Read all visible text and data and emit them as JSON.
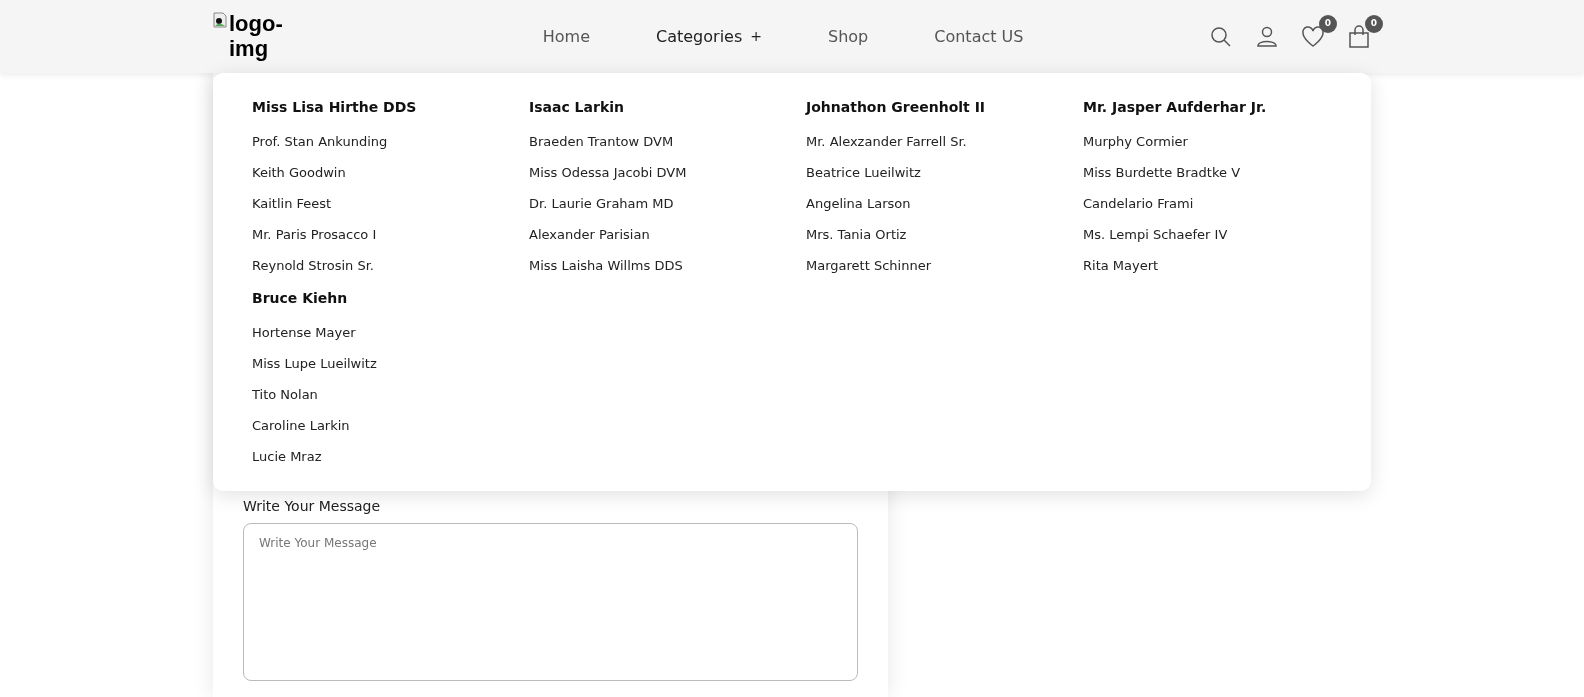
{
  "logo": {
    "line_1": "logo-",
    "line_2": "img"
  },
  "nav": [
    {
      "label": "Home",
      "expanded": false
    },
    {
      "label": "Categories",
      "expanded": true,
      "toggle": "+"
    },
    {
      "label": "Shop",
      "expanded": false
    },
    {
      "label": "Contact US",
      "expanded": false
    }
  ],
  "actions": [
    {
      "kind": "search"
    },
    {
      "kind": "account"
    },
    {
      "kind": "wishlist",
      "count": "0"
    },
    {
      "kind": "cart",
      "count": "0"
    }
  ],
  "mega_menu": [
    {
      "title": "Miss Lisa Hirthe DDS",
      "items": [
        "Prof. Stan Ankunding",
        "Keith Goodwin",
        "Kaitlin Feest",
        "Mr. Paris Prosacco I",
        "Reynold Strosin Sr."
      ]
    },
    {
      "title": "Isaac Larkin",
      "items": [
        "Braeden Trantow DVM",
        "Miss Odessa Jacobi DVM",
        "Dr. Laurie Graham MD",
        "Alexander Parisian",
        "Miss Laisha Willms DDS"
      ]
    },
    {
      "title": "Johnathon Greenholt II",
      "items": [
        "Mr. Alexzander Farrell Sr.",
        "Beatrice Lueilwitz",
        "Angelina Larson",
        "Mrs. Tania Ortiz",
        "Margarett Schinner"
      ]
    },
    {
      "title": "Mr. Jasper Aufderhar Jr.",
      "items": [
        "Murphy Cormier",
        "Miss Burdette Bradtke V",
        "Candelario Frami",
        "Ms. Lempi Schaefer IV",
        "Rita Mayert"
      ]
    },
    {
      "title": "Bruce Kiehn",
      "items": [
        "Hortense Mayer",
        "Miss Lupe Lueilwitz",
        "Tito Nolan",
        "Caroline Larkin",
        "Lucie Mraz"
      ]
    }
  ],
  "form": {
    "label": "Write Your Message",
    "placeholder": "Write Your Message"
  }
}
